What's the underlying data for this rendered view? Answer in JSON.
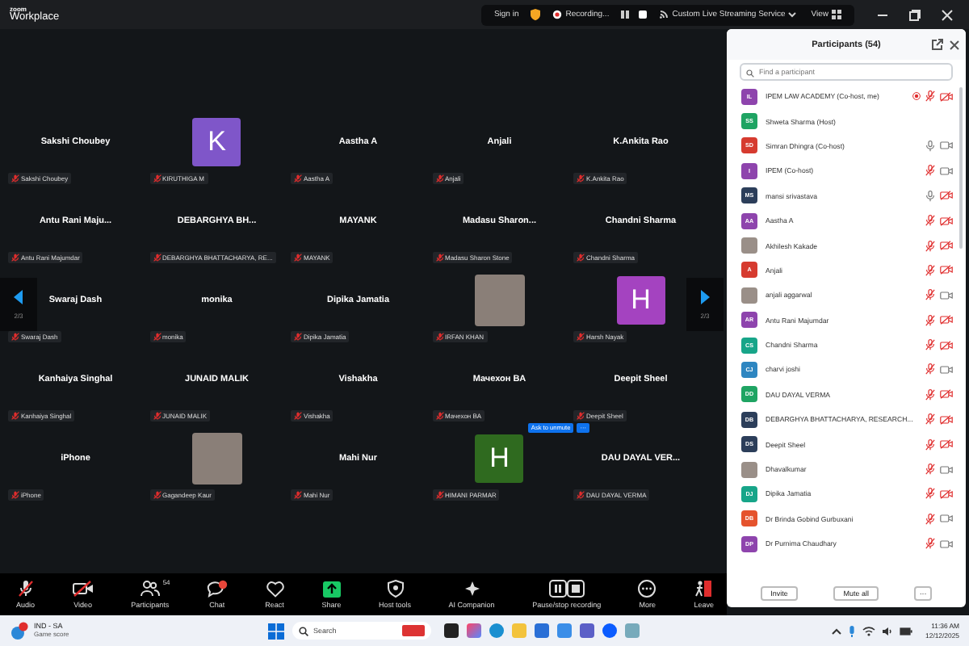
{
  "window": {
    "logo_top": "zoom",
    "logo_bottom": "Workplace"
  },
  "top_bar": {
    "sign_in": "Sign in",
    "recording": "Recording...",
    "stream": "Custom Live Streaming Service",
    "view": "View"
  },
  "gallery": {
    "page_left": "2/3",
    "page_right": "2/3",
    "tiles": [
      {
        "kind": "name",
        "name": "Sakshi Choubey",
        "label": "Sakshi Choubey",
        "muted": true
      },
      {
        "kind": "letter",
        "letter": "K",
        "color": "#7f56c9",
        "label": "KIRUTHIGA M",
        "muted": true
      },
      {
        "kind": "name",
        "name": "Aastha A",
        "label": "Aastha A",
        "muted": true
      },
      {
        "kind": "name",
        "name": "Anjali",
        "label": "Anjali",
        "muted": true
      },
      {
        "kind": "name",
        "name": "K.Ankita Rao",
        "label": "K.Ankita Rao",
        "muted": true
      },
      {
        "kind": "name",
        "name": "Antu  Rani  Maju...",
        "label": "Antu Rani Majumdar",
        "muted": true
      },
      {
        "kind": "name",
        "name": "DEBARGHYA  BH...",
        "label": "DEBARGHYA BHATTACHARYA, RE...",
        "muted": true
      },
      {
        "kind": "name",
        "name": "MAYANK",
        "label": "MAYANK",
        "muted": true
      },
      {
        "kind": "name",
        "name": "Madasu  Sharon...",
        "label": "Madasu Sharon Stone",
        "muted": true
      },
      {
        "kind": "name",
        "name": "Chandni Sharma",
        "label": "Chandni Sharma",
        "muted": true
      },
      {
        "kind": "name",
        "name": "Swaraj Dash",
        "label": "Swaraj Dash",
        "muted": true
      },
      {
        "kind": "name",
        "name": "monika",
        "label": "monika",
        "muted": true
      },
      {
        "kind": "name",
        "name": "Dipika Jamatia",
        "label": "Dipika Jamatia",
        "muted": true
      },
      {
        "kind": "photo",
        "label": "IRFAN KHAN",
        "muted": true
      },
      {
        "kind": "letter",
        "letter": "H",
        "color": "#a443c0",
        "label": "Harsh Nayak",
        "muted": true
      },
      {
        "kind": "name",
        "name": "Kanhaiya Singhal",
        "label": "Kanhaiya Singhal",
        "muted": true
      },
      {
        "kind": "name",
        "name": "JUNAID MALIK",
        "label": "JUNAID MALIK",
        "muted": true
      },
      {
        "kind": "name",
        "name": "Vishakha",
        "label": "Vishakha",
        "muted": true
      },
      {
        "kind": "name",
        "name": "Мачехон  BA",
        "label": "Мачехон  BA",
        "muted": true
      },
      {
        "kind": "name",
        "name": "Deepit Sheel",
        "label": "Deepit Sheel",
        "muted": true
      },
      {
        "kind": "name",
        "name": "iPhone",
        "label": "iPhone",
        "muted": true
      },
      {
        "kind": "photo",
        "label": "Gagandeep Kaur",
        "muted": true
      },
      {
        "kind": "name",
        "name": "Mahi Nur",
        "label": "Mahi Nur",
        "muted": true
      },
      {
        "kind": "letter",
        "letter": "H",
        "color": "#2f6a1f",
        "label": "HIMANI PARMAR",
        "muted": true,
        "ask_to_unmute": "Ask to unmute",
        "ask_more": "···"
      },
      {
        "kind": "name",
        "name": "DAU DAYAL VER...",
        "label": "DAU DAYAL VERMA",
        "muted": true
      }
    ]
  },
  "toolbar": [
    {
      "kind": "audio",
      "label": "Audio",
      "off": true
    },
    {
      "kind": "video",
      "label": "Video",
      "off": true
    },
    {
      "kind": "participants",
      "label": "Participants",
      "count": "54"
    },
    {
      "kind": "chat",
      "label": "Chat"
    },
    {
      "kind": "react",
      "label": "React"
    },
    {
      "kind": "share",
      "label": "Share"
    },
    {
      "kind": "host",
      "label": "Host tools"
    },
    {
      "kind": "ai",
      "label": "AI Companion"
    },
    {
      "kind": "record",
      "label": "Pause/stop recording"
    },
    {
      "kind": "more",
      "label": "More"
    },
    {
      "kind": "leave",
      "label": "Leave"
    }
  ],
  "participants": {
    "title": "Participants (54)",
    "search": {
      "placeholder": "Find a participant"
    },
    "rows": [
      {
        "avatar": {
          "kind": "initials",
          "initials": "IL",
          "color": "#8e44ad"
        },
        "name": "IPEM LAW ACADEMY (Co-host, me)",
        "recording": true,
        "mic_muted": true,
        "camera_off": true
      },
      {
        "avatar": {
          "kind": "initials",
          "initials": "SS",
          "color": "#1fa463"
        },
        "name": "Shweta Sharma (Host)",
        "recording": false
      },
      {
        "avatar": {
          "kind": "initials",
          "initials": "SD",
          "color": "#d63b2f"
        },
        "name": "Simran Dhingra (Co-host)",
        "recording": false,
        "mic_muted": false,
        "camera_off": false
      },
      {
        "avatar": {
          "kind": "initials",
          "initials": "I",
          "color": "#8e44ad"
        },
        "name": "IPEM (Co-host)",
        "recording": false,
        "mic_muted": true,
        "camera_off": false
      },
      {
        "avatar": {
          "kind": "initials",
          "initials": "MS",
          "color": "#2c3e5a"
        },
        "name": "mansi srivastava",
        "recording": false,
        "mic_muted": false,
        "camera_off": true
      },
      {
        "avatar": {
          "kind": "initials",
          "initials": "AA",
          "color": "#8e44ad"
        },
        "name": "Aastha A",
        "recording": false,
        "mic_muted": true,
        "camera_off": true
      },
      {
        "avatar": {
          "kind": "photo"
        },
        "name": "Akhilesh Kakade",
        "recording": false,
        "mic_muted": true,
        "camera_off": true
      },
      {
        "avatar": {
          "kind": "initials",
          "initials": "A",
          "color": "#d63b2f"
        },
        "name": "Anjali",
        "recording": false,
        "mic_muted": true,
        "camera_off": true
      },
      {
        "avatar": {
          "kind": "photo"
        },
        "name": "anjali aggarwal",
        "recording": false,
        "mic_muted": true,
        "camera_off": false
      },
      {
        "avatar": {
          "kind": "initials",
          "initials": "AR",
          "color": "#8e44ad"
        },
        "name": "Antu Rani Majumdar",
        "recording": false,
        "mic_muted": true,
        "camera_off": true
      },
      {
        "avatar": {
          "kind": "initials",
          "initials": "CS",
          "color": "#17a589"
        },
        "name": "Chandni Sharma",
        "recording": false,
        "mic_muted": true,
        "camera_off": true
      },
      {
        "avatar": {
          "kind": "initials",
          "initials": "CJ",
          "color": "#2e86c1"
        },
        "name": "charvi joshi",
        "recording": false,
        "mic_muted": true,
        "camera_off": false
      },
      {
        "avatar": {
          "kind": "initials",
          "initials": "DD",
          "color": "#1fa463"
        },
        "name": "DAU DAYAL VERMA",
        "recording": false,
        "mic_muted": true,
        "camera_off": true
      },
      {
        "avatar": {
          "kind": "initials",
          "initials": "DB",
          "color": "#2c3e5a"
        },
        "name": "DEBARGHYA BHATTACHARYA, RESEARCH...",
        "recording": false,
        "mic_muted": true,
        "camera_off": true
      },
      {
        "avatar": {
          "kind": "initials",
          "initials": "DS",
          "color": "#2c3e5a"
        },
        "name": "Deepit Sheel",
        "recording": false,
        "mic_muted": true,
        "camera_off": true
      },
      {
        "avatar": {
          "kind": "photo"
        },
        "name": "Dhavalkumar",
        "recording": false,
        "mic_muted": true,
        "camera_off": false
      },
      {
        "avatar": {
          "kind": "initials",
          "initials": "DJ",
          "color": "#17a589"
        },
        "name": "Dipika Jamatia",
        "recording": false,
        "mic_muted": true,
        "camera_off": true
      },
      {
        "avatar": {
          "kind": "initials",
          "initials": "DB",
          "color": "#e5532d"
        },
        "name": "Dr Brinda Gobind Gurbuxani",
        "recording": false,
        "mic_muted": true,
        "camera_off": false
      },
      {
        "avatar": {
          "kind": "initials",
          "initials": "DP",
          "color": "#8e44ad"
        },
        "name": "Dr Purnima Chaudhary",
        "recording": false,
        "mic_muted": true,
        "camera_off": false
      }
    ],
    "buttons": [
      "Invite",
      "Mute all",
      "···"
    ]
  },
  "taskbar": {
    "weather_title": "IND - SA",
    "weather_sub": "Game score",
    "search": "Search",
    "time": "11:36 AM",
    "date": "12/12/2025"
  }
}
